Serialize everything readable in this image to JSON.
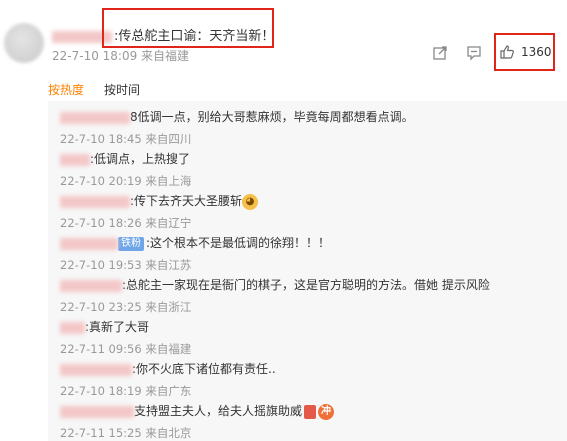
{
  "post": {
    "text": ":传总舵主口谕：天齐当新！",
    "meta": "22-7-10 18:09 来自福建",
    "like_count": "1360"
  },
  "icons": {
    "share": "share-icon",
    "comment": "comment-icon",
    "like": "thumbs-up-icon"
  },
  "sort": {
    "hot": "按热度",
    "time": "按时间"
  },
  "replies": [
    {
      "text": "8低调一点，别给大哥惹麻烦，毕竟每周都想看点调。",
      "meta": "22-7-10 18:45 来自四川"
    },
    {
      "text": ":低调点，上热搜了",
      "meta": "22-7-10 20:19 来自上海"
    },
    {
      "text": ":传下去齐天大圣腰斩",
      "meta": "22-7-10 18:26 来自辽宁"
    },
    {
      "tag": "铁粉",
      "text": ":这个根本不是最低调的徐翔！！！",
      "meta": "22-7-10 19:53 来自江苏"
    },
    {
      "text": ":总舵主一家现在是衙门的棋子，这是官方聪明的方法。借她 提示风险",
      "meta": "22-7-10 23:25 来自浙江"
    },
    {
      "text": ":真新了大哥",
      "meta": "22-7-11 09:56 来自福建"
    },
    {
      "text": ":你不火底下诸位都有责任..",
      "meta": "22-7-10 18:19 来自广东"
    },
    {
      "text": "支持盟主夫人，给夫人摇旗助威",
      "meta": "22-7-11 15:25 来自北京"
    }
  ],
  "colors": {
    "accent": "#ff8200",
    "highlight_box": "#e0261a",
    "tag": "#6fa6e8"
  }
}
